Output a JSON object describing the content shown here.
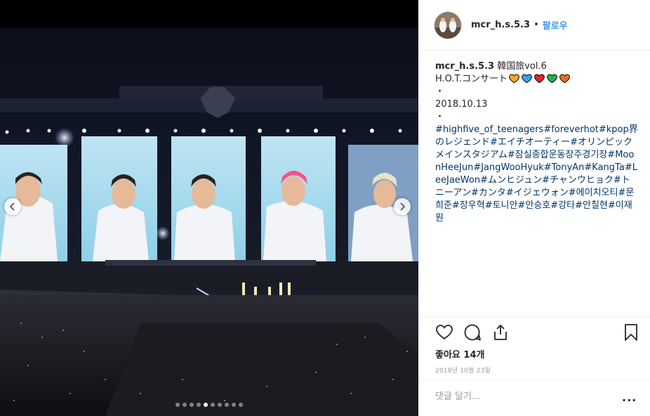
{
  "header": {
    "username": "mcr_h.s.5.3",
    "separator": "•",
    "follow_label": "팔로우"
  },
  "caption": {
    "username": "mcr_h.s.5.3",
    "title": "韓国旅vol.6",
    "subtitle": "H.O.T.コンサート",
    "hearts": [
      "#f5a623",
      "#3aa0e6",
      "#e8202a",
      "#21b14b",
      "#f26b21"
    ],
    "bullet": "・",
    "date": "2018.10.13",
    "hashtags": [
      "#highfive_of_teenagers",
      "#foreverhot",
      "#kpop界のレジェンド",
      "#エイチオーティー",
      "#オリンピックメインスタジアム",
      "#잠실종합운동장주경기장",
      "#MoonHeeJun",
      "#JangWooHyuk",
      "#TonyAn",
      "#KangTa",
      "#LeeJaeWon",
      "#ムンヒジュン",
      "#チャンウヒョク",
      "#トニーアン",
      "#カンタ",
      "#イジェウォン",
      "#에이치오티",
      "#문희준",
      "#장우혁",
      "#토니안",
      "#안승호",
      "#강타",
      "#안칠현",
      "#이재원"
    ],
    "hashtag_color": "#003569"
  },
  "actions": {
    "like_icon": "heart-outline-icon",
    "comment_icon": "comment-bubble-icon",
    "share_icon": "share-upload-icon",
    "save_icon": "bookmark-icon"
  },
  "likes_text": "좋아요 14개",
  "post_date": "2018년 10월 23일",
  "comment": {
    "placeholder": "댓글 달기...",
    "more_label": "..."
  },
  "carousel": {
    "dot_count": 10,
    "active_index": 4,
    "prev_icon": "chevron-left-icon",
    "next_icon": "chevron-right-icon"
  },
  "colors": {
    "link_blue": "#3897f0",
    "text": "#262626",
    "muted": "#999999"
  }
}
